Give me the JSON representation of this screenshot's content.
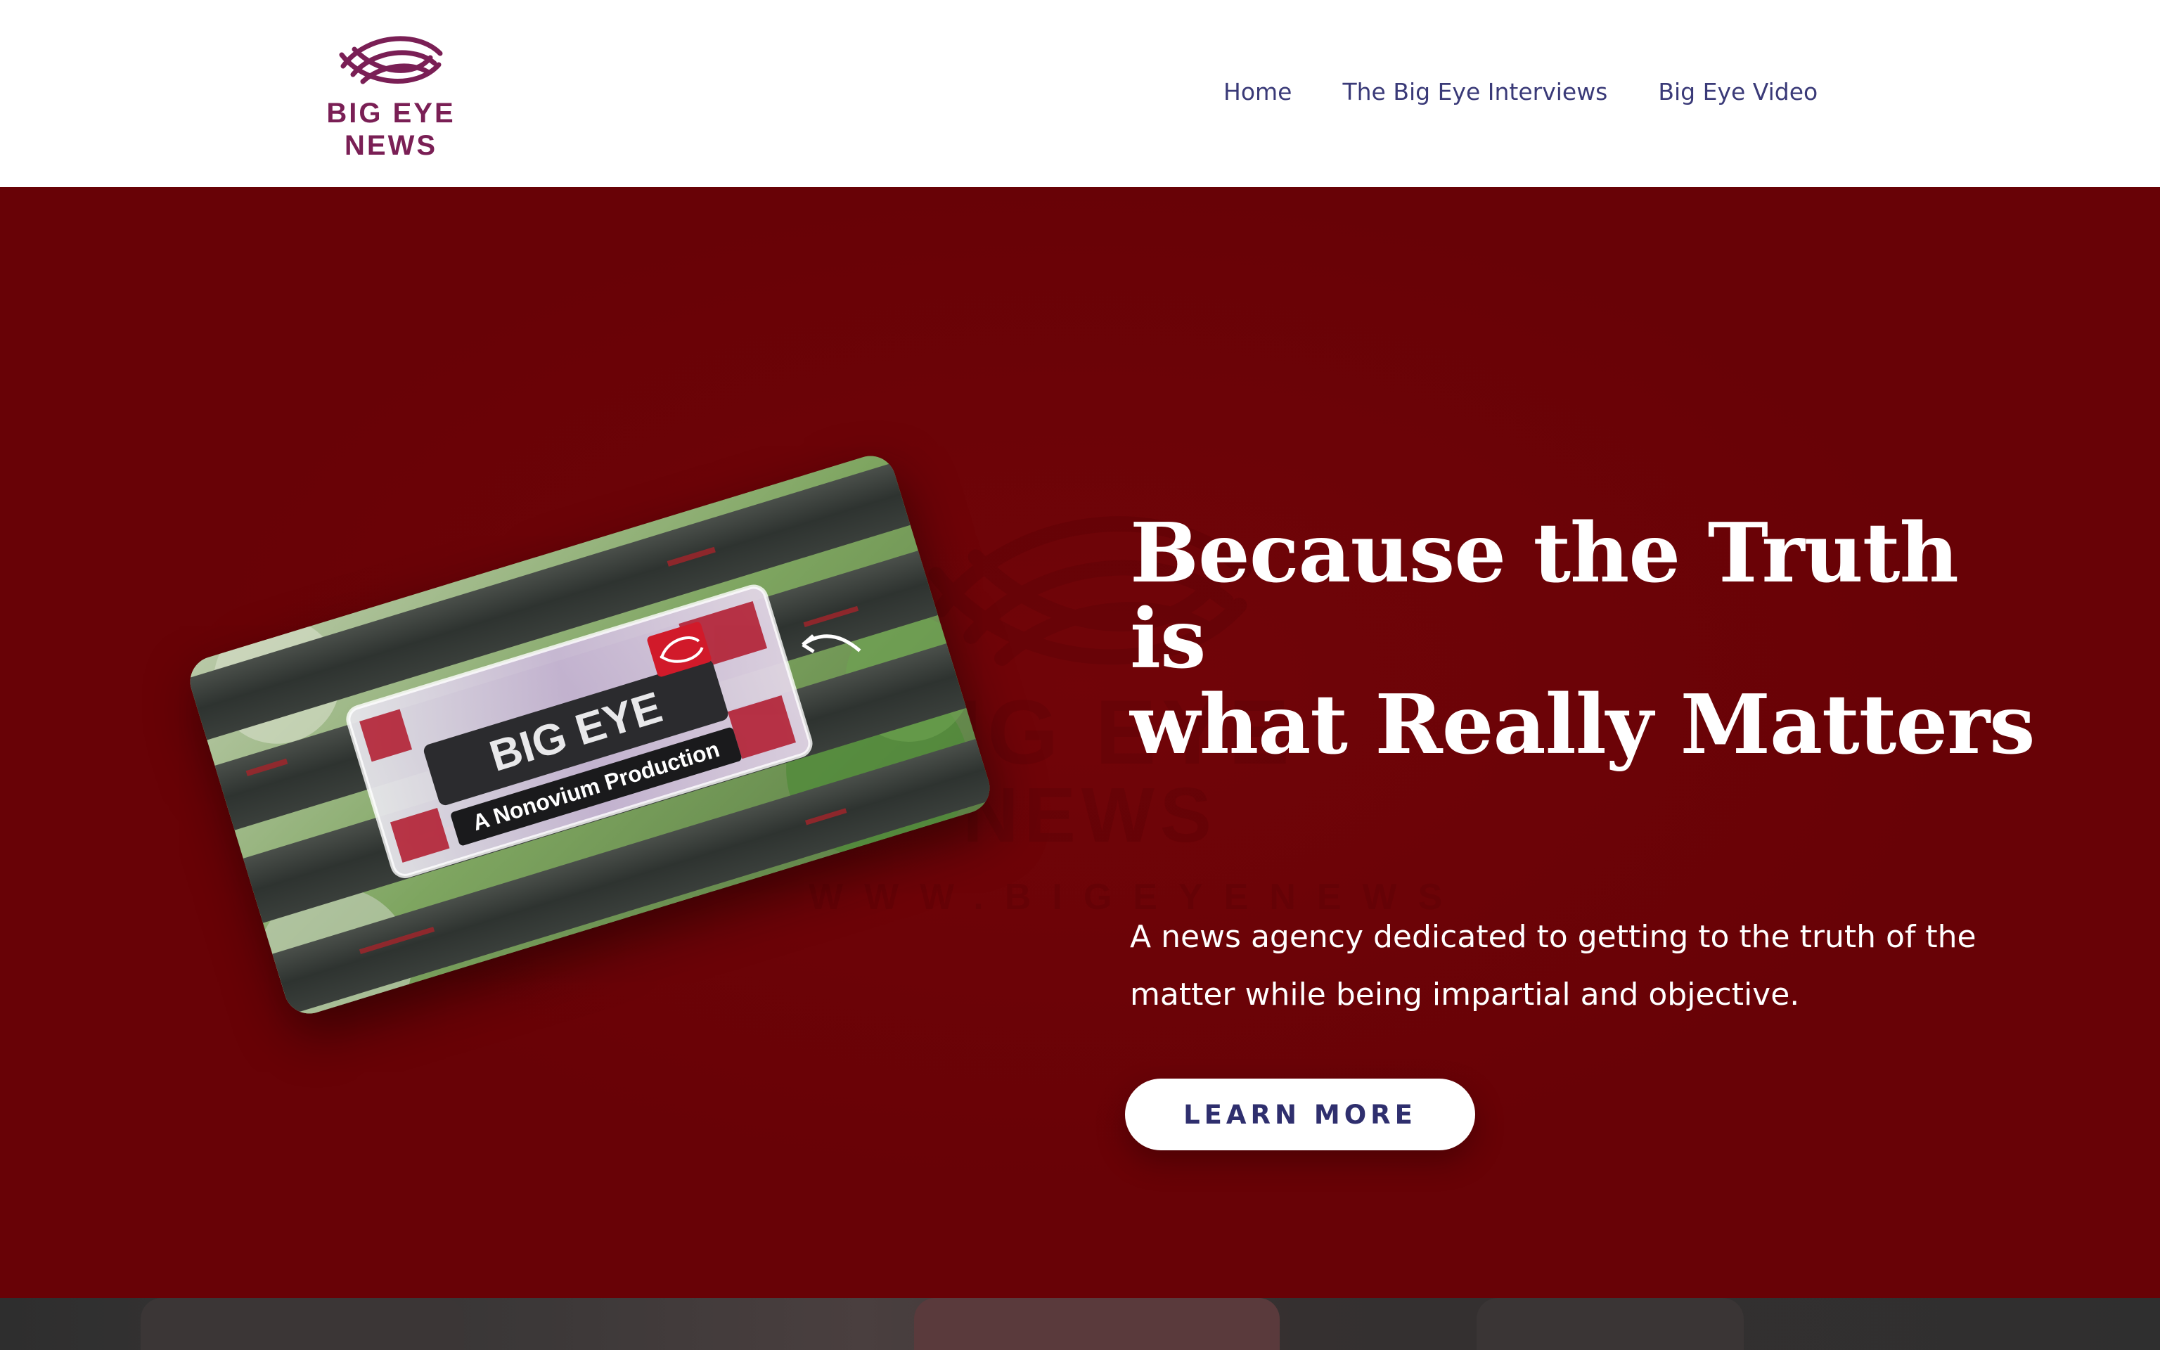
{
  "brand": {
    "name_line1": "BIG EYE",
    "name_line2": "NEWS",
    "color": "#7a1f55"
  },
  "nav": {
    "items": [
      {
        "label": "Home"
      },
      {
        "label": "The Big Eye Interviews"
      },
      {
        "label": "Big Eye Video"
      }
    ],
    "color": "#3a3a78"
  },
  "hero": {
    "background": "#680206",
    "heading_line1": "Because the Truth is",
    "heading_line2": "what Really Matters",
    "subtitle_line1": "A news agency dedicated to getting to the truth of the",
    "subtitle_line2": "matter while being impartial and objective.",
    "cta_label": "LEARN MORE",
    "watermark": {
      "line1": "BIG EYE",
      "line2": "NEWS",
      "line3": "WWW.BIGEYENEWS"
    },
    "card_image": {
      "icon": "big-eye-logo-icon",
      "sign_text": "BIG EYE",
      "sign_subtext": "A Nonovium Production"
    }
  }
}
